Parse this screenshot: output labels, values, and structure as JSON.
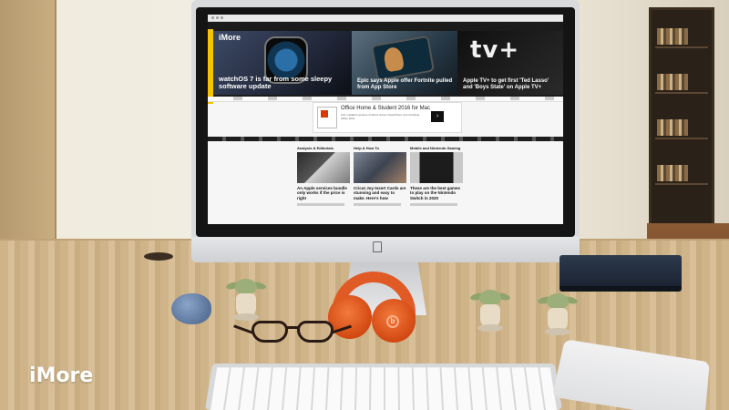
{
  "browser_page": {
    "site_logo": "iMore",
    "hero_stories": [
      {
        "caption": "watchOS 7 is far from some sleepy software update"
      },
      {
        "caption": "Epic says Apple offer Fortnite pulled from App Store"
      },
      {
        "caption": "Apple TV+ to get first 'Ted Lasso' and 'Boys State' on Apple TV+"
      }
    ],
    "tv_logo": "tv+",
    "ad": {
      "title": "Office Home & Student 2016 for Mac",
      "subtitle": "Full, installed versions of Word, Excel, PowerPoint, and OneNote. Office 2016",
      "button": "›"
    },
    "columns": [
      {
        "heading": "Analysis & Editorials",
        "headline": "An Apple services bundle only works if the price is right"
      },
      {
        "heading": "Help & How To",
        "headline": "Cricut Joy Insert Cards are stunning and easy to make. Here's how"
      },
      {
        "heading": "Mobile and Nintendo Gaming",
        "headline": "These are the best games to play on the Nintendo Switch in 2020"
      }
    ]
  },
  "watermark": "iMore",
  "colors": {
    "imore_yellow": "#f4c400",
    "headphones_orange": "#e05a26",
    "desk_wood": "#d8bf97"
  }
}
